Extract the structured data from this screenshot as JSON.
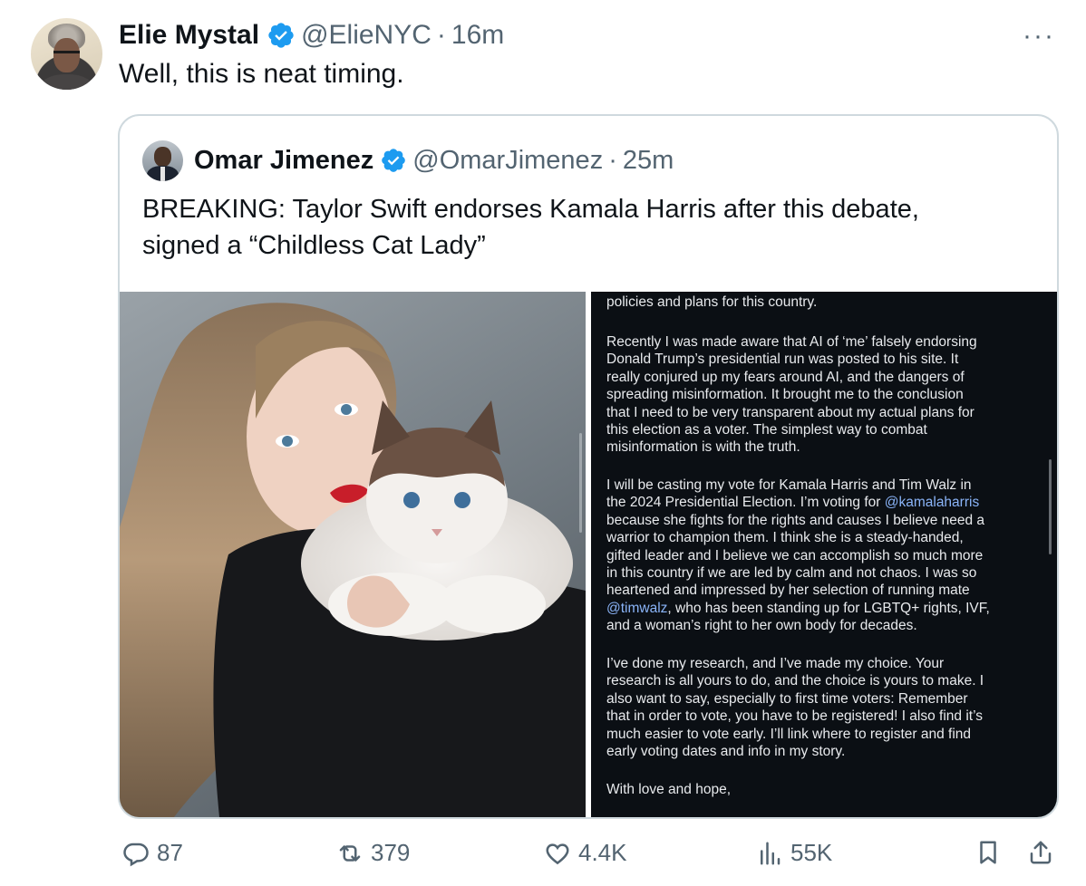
{
  "tweet": {
    "author_name": "Elie Mystal",
    "handle": "@ElieNYC",
    "separator": "·",
    "time": "16m",
    "text": "Well, this is neat timing.",
    "more_label": "···"
  },
  "quoted": {
    "author_name": "Omar Jimenez",
    "handle": "@OmarJimenez",
    "separator": "·",
    "time": "25m",
    "text_line1": "BREAKING: Taylor Swift endorses Kamala Harris after this debate,",
    "text_line2": "signed a “Childless Cat Lady”",
    "statement": {
      "p0": "policies and plans for this country.",
      "p1_lines": [
        "Recently I was made aware that AI of ‘me’ falsely endorsing",
        "Donald Trump’s presidential run was posted to his site. It",
        "really conjured up my fears around AI, and the dangers of",
        "spreading misinformation. It brought me to the conclusion",
        "that I need to be very transparent about my actual plans for",
        "this election as a voter. The simplest way to combat",
        "misinformation is with the truth."
      ],
      "p2_line1": "I will be casting my vote for Kamala Harris and Tim Walz in",
      "p2_line2_pre": "the 2024 Presidential Election. I’m voting for ",
      "p2_mention1": "@kamalaharris",
      "p2_mid_lines": [
        "because she fights for the rights and causes I believe need a",
        "warrior to champion them. I think she is a steady-handed,",
        "gifted leader and I believe we can accomplish so much more",
        "in this country if we are led by calm and not chaos. I was so",
        "heartened and impressed by her selection of running mate"
      ],
      "p2_mention2": "@timwalz",
      "p2_line_after_mention": ", who has been standing up for LGBTQ+ rights, IVF,",
      "p2_last": "and a woman’s right to her own body for decades.",
      "p3_lines": [
        "I’ve done my research, and I’ve made my choice. Your",
        "research is all yours to do, and the choice is yours to make. I",
        "also want to say, especially to first time voters: Remember",
        "that in order to vote, you have to be registered! I also find it’s",
        "much easier to vote early. I’ll link where to register and find",
        "early voting dates and info in my story."
      ],
      "p4": "With love and hope,"
    }
  },
  "actions": {
    "replies": "87",
    "reposts": "379",
    "likes": "4.4K",
    "views": "55K"
  },
  "colors": {
    "verified": "#1d9bf0",
    "muted": "#536471",
    "mention": "#8ab4f8"
  }
}
